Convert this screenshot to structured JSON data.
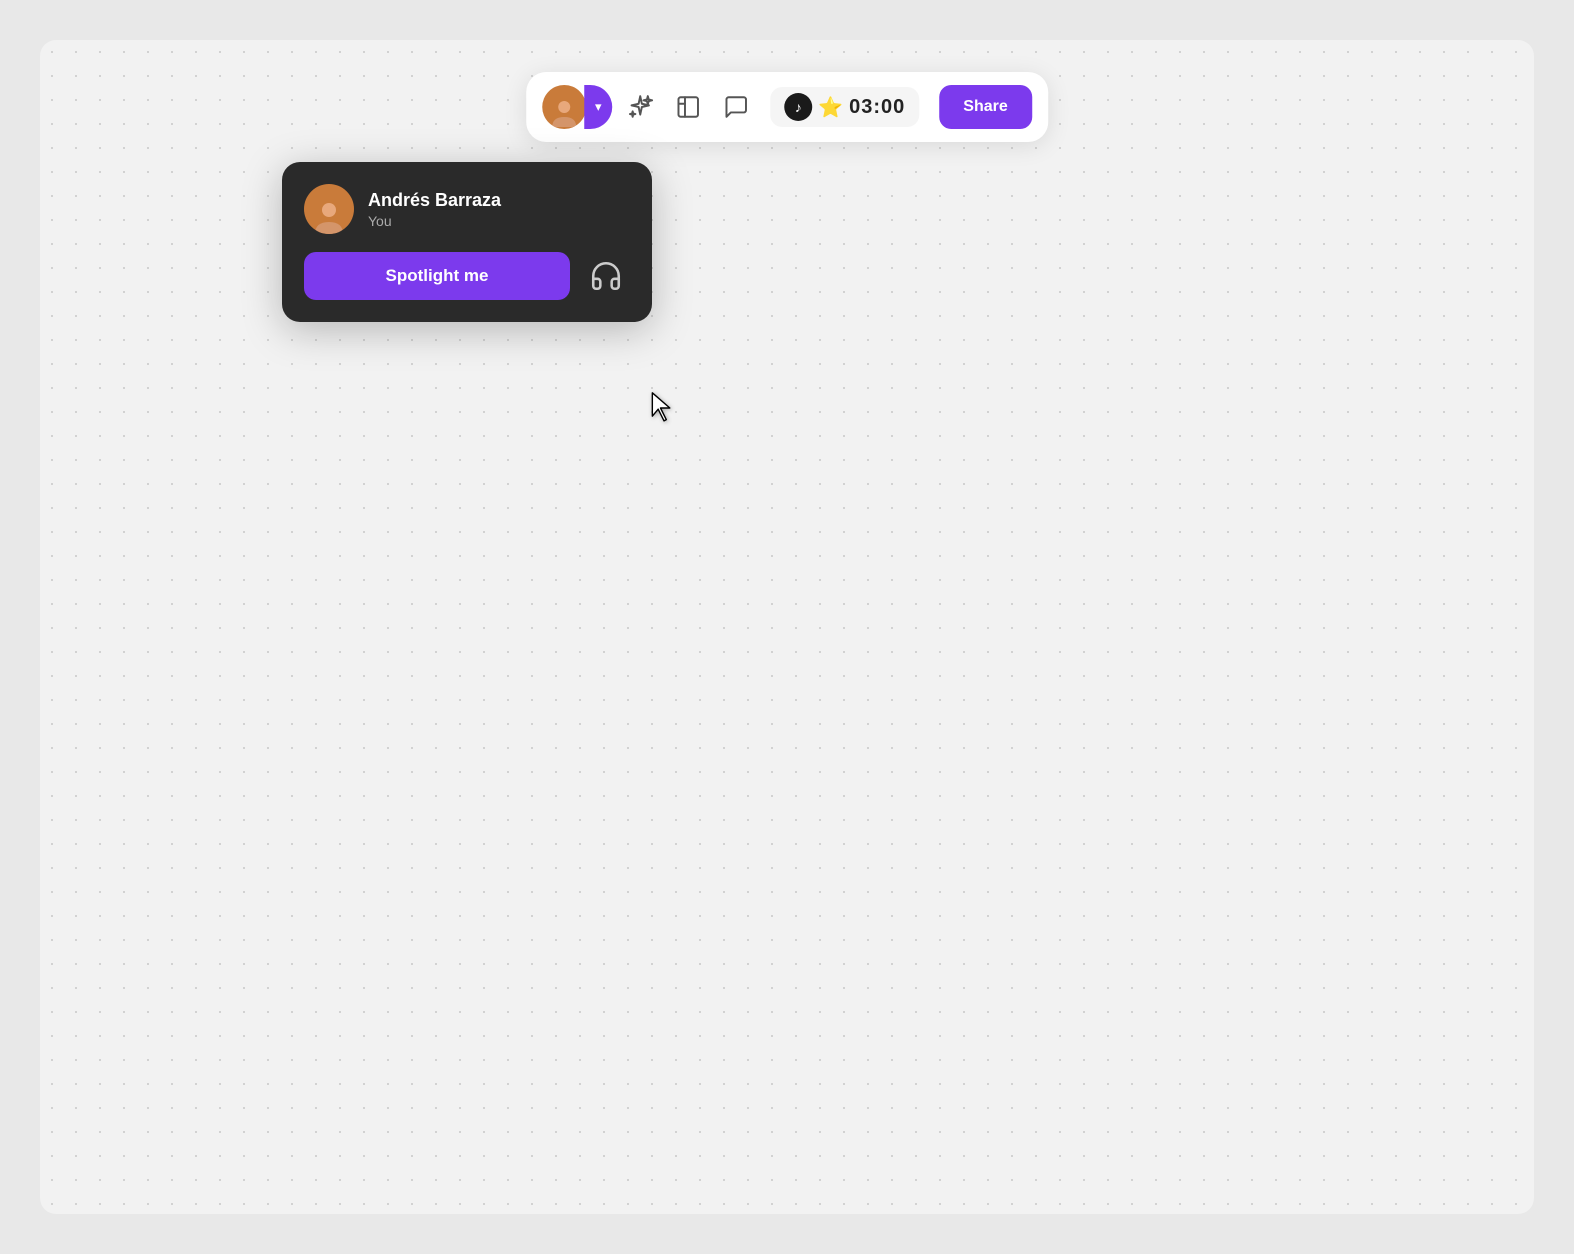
{
  "toolbar": {
    "avatar_alt": "Andrés Barraza avatar",
    "dropdown_label": "▾",
    "sparkle_icon": "sparkle",
    "layout_icon": "layout",
    "chat_icon": "chat",
    "timer_value": "03:00",
    "share_label": "Share"
  },
  "popup": {
    "user_name": "Andrés Barraza",
    "user_sub": "You",
    "spotlight_btn": "Spotlight me",
    "headphones_icon": "headphones"
  },
  "colors": {
    "accent": "#7c3aed",
    "popup_bg": "#2a2a2a",
    "toolbar_bg": "#ffffff"
  }
}
